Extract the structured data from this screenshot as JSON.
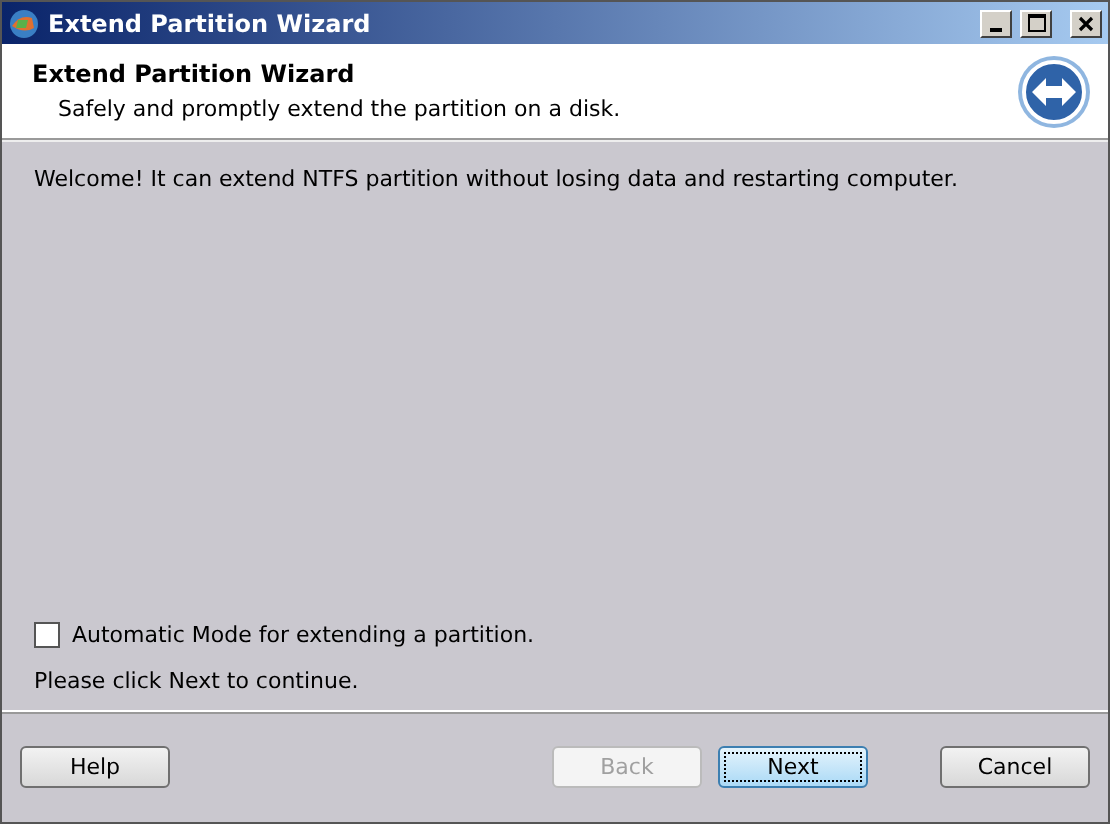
{
  "window": {
    "title": "Extend Partition Wizard"
  },
  "header": {
    "title": "Extend Partition Wizard",
    "subtitle": "Safely and promptly extend the partition on a disk."
  },
  "welcome": "Welcome! It can extend NTFS partition without losing data and restarting computer.",
  "auto_mode": {
    "label": "Automatic Mode for extending a partition.",
    "checked": false
  },
  "hint": "Please click Next to continue.",
  "buttons": [
    {
      "label": "Help",
      "disabled": false,
      "focused": false
    },
    {
      "label": "Back",
      "disabled": true,
      "focused": false
    },
    {
      "label": "Next",
      "disabled": false,
      "focused": true
    },
    {
      "label": "Cancel",
      "disabled": false,
      "focused": false
    }
  ]
}
